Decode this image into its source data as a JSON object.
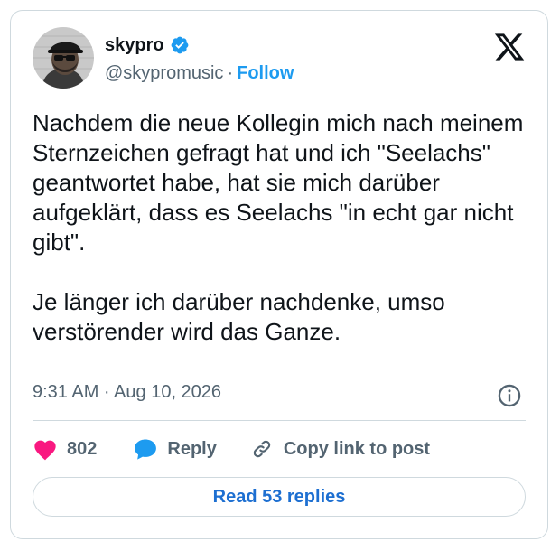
{
  "author": {
    "display_name": "skypro",
    "handle": "@skypromusic",
    "separator": "·",
    "follow_label": "Follow",
    "verified": true
  },
  "tweet": {
    "paragraphs": [
      "Nachdem die neue Kollegin mich nach meinem Sternzeichen gefragt hat und ich \"Seelachs\" geantwortet habe, hat sie mich darüber aufgeklärt, dass es Seelachs \"in echt gar nicht gibt\".",
      "Je länger ich darüber nachdenke, umso verstörender wird das Ganze."
    ],
    "timestamp": "9:31 AM · Aug 10, 2026"
  },
  "actions": {
    "like_count": "802",
    "reply_label": "Reply",
    "copy_link_label": "Copy link to post",
    "read_replies_label": "Read 53 replies"
  },
  "icons": {
    "verified": "verified-badge-icon",
    "brand": "x-logo-icon",
    "info": "info-icon",
    "like": "heart-icon",
    "reply": "speech-bubble-icon",
    "copy_link": "link-icon"
  },
  "colors": {
    "accent": "#1d9bf0",
    "like": "#f91880",
    "text_primary": "#0f1419",
    "text_secondary": "#536471",
    "border": "#cfd9de"
  }
}
